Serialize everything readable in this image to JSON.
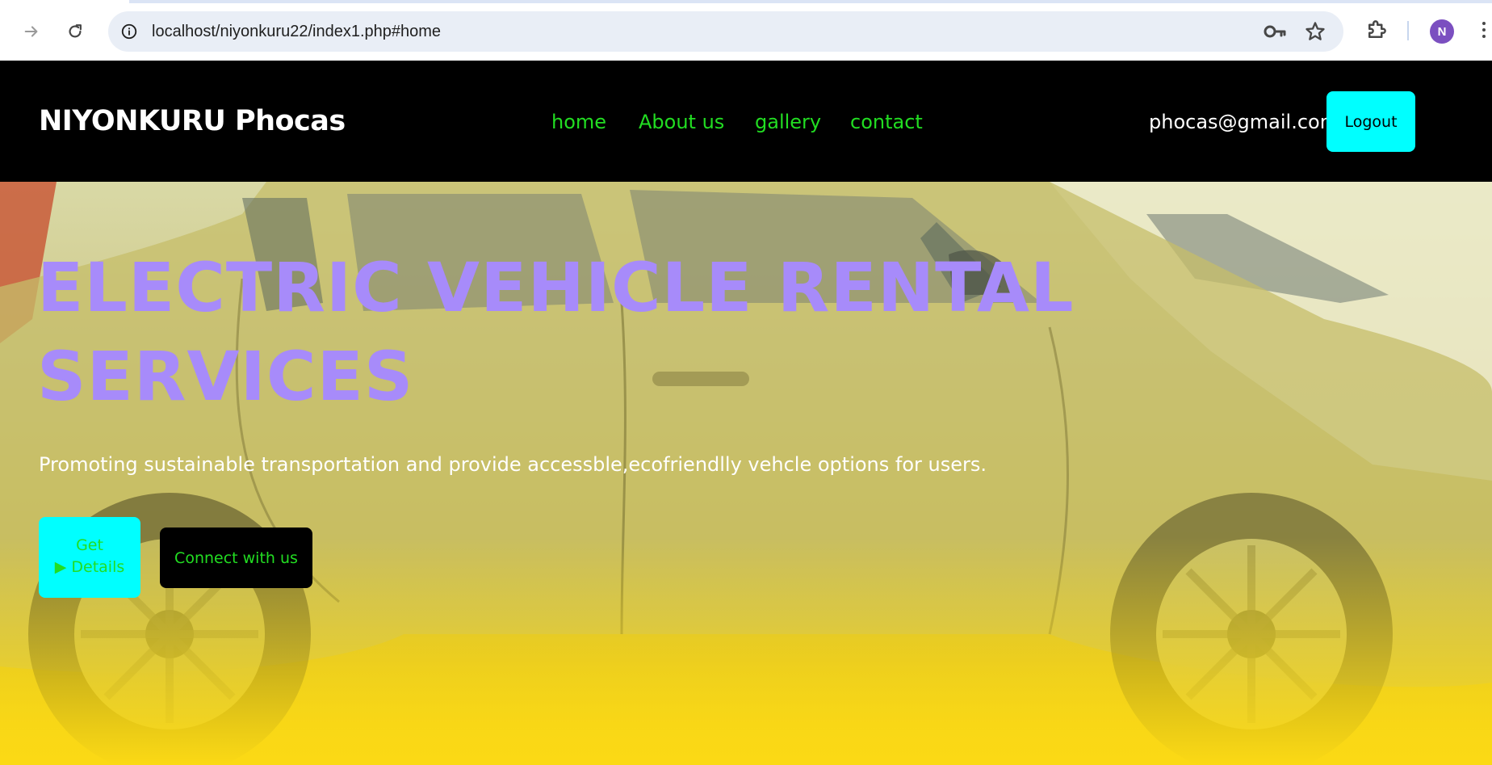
{
  "browser": {
    "url": "localhost/niyonkuru22/index1.php#home",
    "profile_initial": "N"
  },
  "site": {
    "brand": "NIYONKURU Phocas",
    "menu": [
      "home",
      "About us",
      "gallery",
      "contact"
    ],
    "user_email": "phocas@gmail.com",
    "logout_label": "Logout"
  },
  "hero": {
    "title_line1": "ELECTRIC VEHICLE RENTAL",
    "title_line2": "SERVICES",
    "subtitle": "Promoting sustainable transportation and provide accessble,ecofriendlly vehcle options for users.",
    "details_button_line1": "Get",
    "details_button_line2": "▶ Details",
    "connect_button": "Connect with us"
  },
  "colors": {
    "header_bg": "#000000",
    "menu_link": "#22dd22",
    "accent_button": "#00ffff",
    "hero_title": "#a78bfa",
    "hero_bottom": "#fad816"
  }
}
